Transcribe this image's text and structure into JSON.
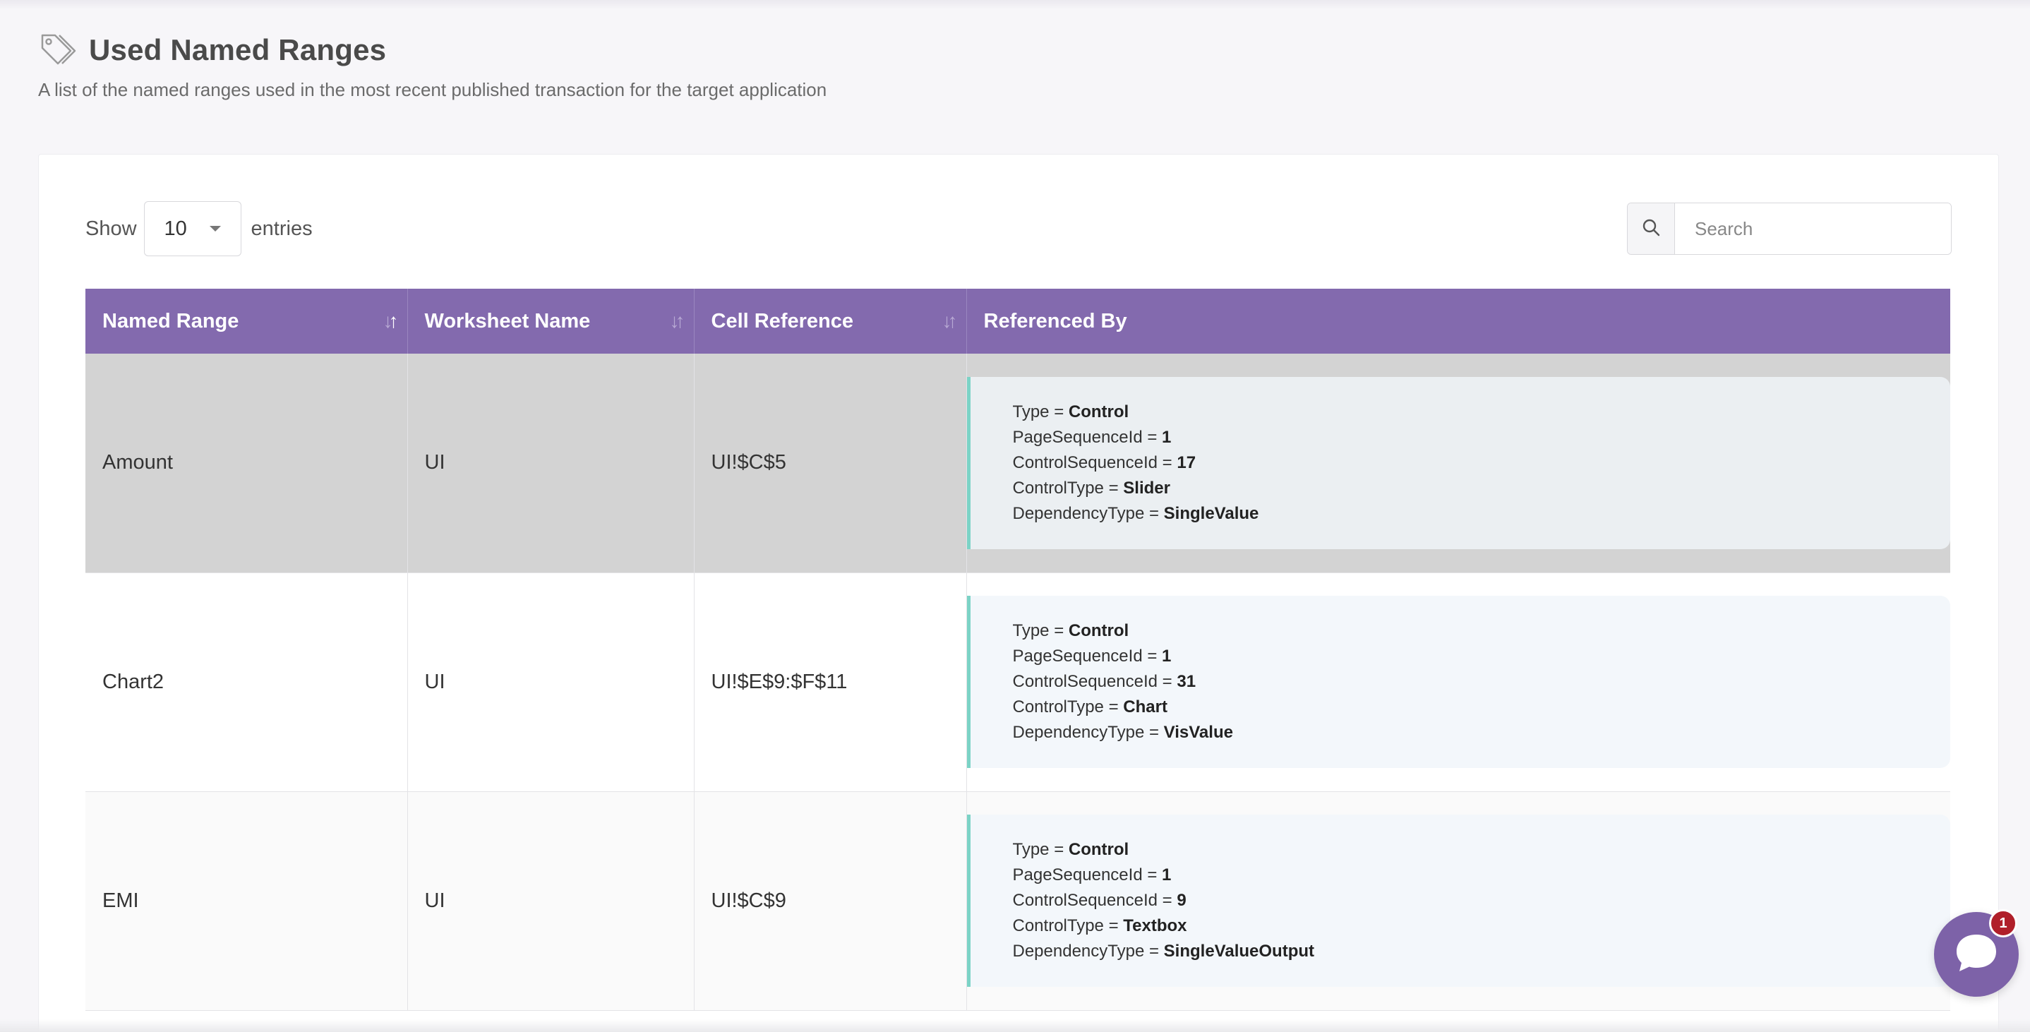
{
  "header": {
    "title": "Used Named Ranges",
    "subtitle": "A list of the named ranges used in the most recent published transaction for the target application"
  },
  "length_control": {
    "prefix": "Show",
    "selected": "10",
    "suffix": "entries"
  },
  "search": {
    "placeholder": "Search",
    "value": ""
  },
  "table": {
    "columns": [
      "Named Range",
      "Worksheet Name",
      "Cell Reference",
      "Referenced By"
    ],
    "rows": [
      {
        "named_range": "Amount",
        "worksheet": "UI",
        "cell_reference": "UI!$C$5",
        "referenced_by": [
          {
            "key": "Type",
            "value": "Control"
          },
          {
            "key": "PageSequenceId",
            "value": "1"
          },
          {
            "key": "ControlSequenceId",
            "value": "17"
          },
          {
            "key": "ControlType",
            "value": "Slider"
          },
          {
            "key": "DependencyType",
            "value": "SingleValue"
          }
        ]
      },
      {
        "named_range": "Chart2",
        "worksheet": "UI",
        "cell_reference": "UI!$E$9:$F$11",
        "referenced_by": [
          {
            "key": "Type",
            "value": "Control"
          },
          {
            "key": "PageSequenceId",
            "value": "1"
          },
          {
            "key": "ControlSequenceId",
            "value": "31"
          },
          {
            "key": "ControlType",
            "value": "Chart"
          },
          {
            "key": "DependencyType",
            "value": "VisValue"
          }
        ]
      },
      {
        "named_range": "EMI",
        "worksheet": "UI",
        "cell_reference": "UI!$C$9",
        "referenced_by": [
          {
            "key": "Type",
            "value": "Control"
          },
          {
            "key": "PageSequenceId",
            "value": "1"
          },
          {
            "key": "ControlSequenceId",
            "value": "9"
          },
          {
            "key": "ControlType",
            "value": "Textbox"
          },
          {
            "key": "DependencyType",
            "value": "SingleValueOutput"
          }
        ]
      }
    ]
  },
  "chat": {
    "badge_count": "1"
  },
  "colors": {
    "header_purple": "#836aae",
    "accent_teal": "#7cd3c6",
    "badge_red": "#b01f2a"
  }
}
